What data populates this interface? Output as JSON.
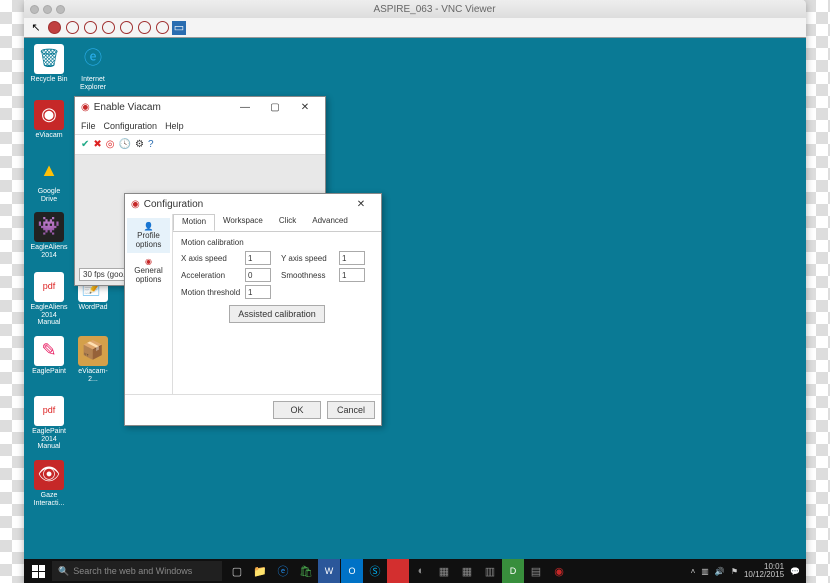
{
  "vnc": {
    "title": "ASPIRE_063 - VNC Viewer"
  },
  "desktop_icons": {
    "recycle": "Recycle Bin",
    "ie": "Internet Explorer",
    "eviacam": "eViacam",
    "gdrive": "Google Drive",
    "eaglealiens": "EagleAliens 2014",
    "eaglemanual": "EagleAliens 2014 Manual",
    "eaglepaint": "EaglePaint",
    "eaglepaintmanual": "EaglePaint 2014 Manual",
    "gaze": "Gaze Interacti...",
    "wordpad": "WordPad",
    "eviacam2": "eViacam-2..."
  },
  "enable_viacam": {
    "title": "Enable Viacam",
    "menu": {
      "file": "File",
      "config": "Configuration",
      "help": "Help"
    },
    "fps": "30 fps (goo..."
  },
  "config": {
    "title": "Configuration",
    "side": {
      "profile": "Profile options",
      "general": "General options"
    },
    "tabs": {
      "motion": "Motion",
      "workspace": "Workspace",
      "click": "Click",
      "advanced": "Advanced"
    },
    "section": "Motion calibration",
    "labels": {
      "xspeed": "X axis speed",
      "yspeed": "Y axis speed",
      "accel": "Acceleration",
      "smooth": "Smoothness",
      "threshold": "Motion threshold"
    },
    "values": {
      "xspeed": "1",
      "yspeed": "1",
      "accel": "0",
      "smooth": "1",
      "threshold": "1"
    },
    "assisted": "Assisted calibration",
    "ok": "OK",
    "cancel": "Cancel"
  },
  "taskbar": {
    "search_placeholder": "Search the web and Windows",
    "time": "10:01",
    "date": "10/12/2015"
  }
}
